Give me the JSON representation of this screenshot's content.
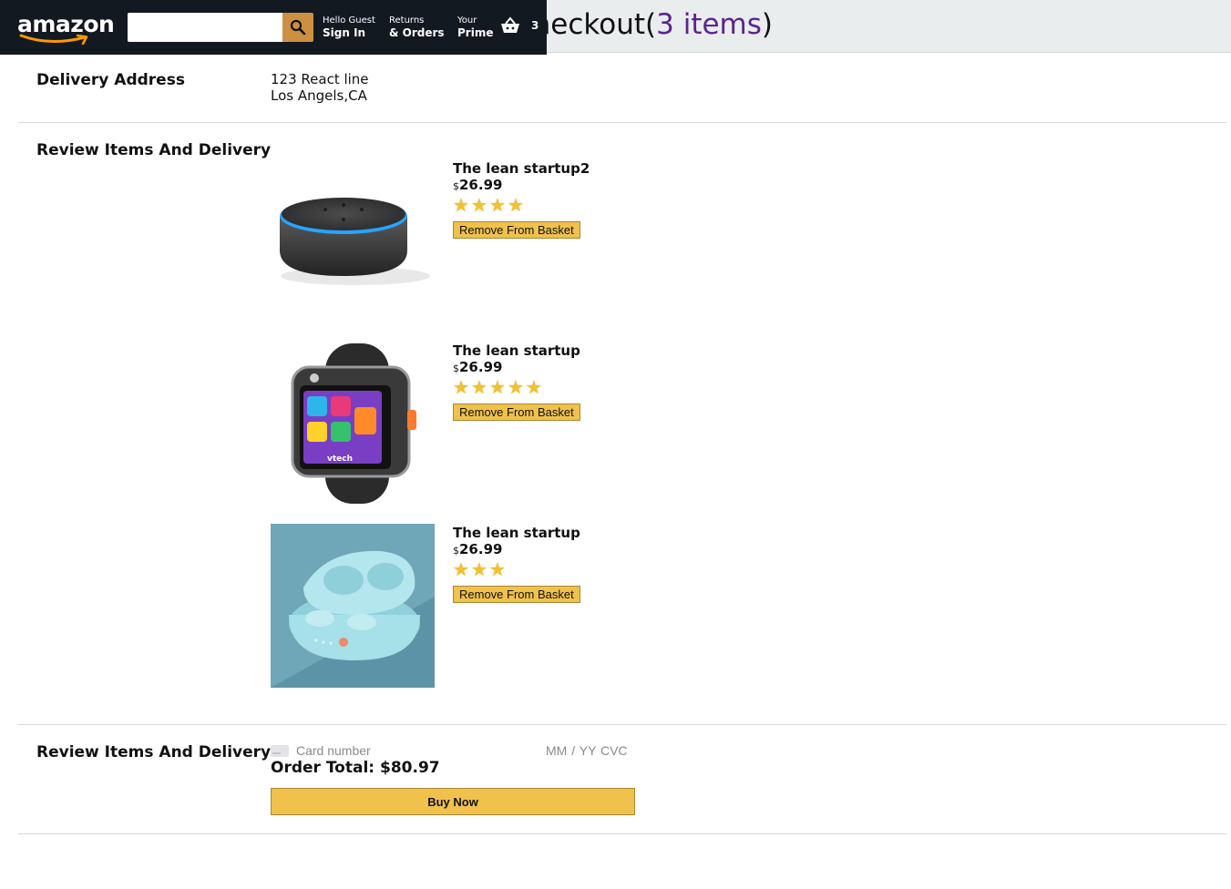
{
  "header": {
    "logo_text": "amazon",
    "search": {
      "value": "",
      "placeholder": ""
    },
    "nav": [
      {
        "line1": "Hello Guest",
        "line2": "Sign In"
      },
      {
        "line1": "Returns",
        "line2": "& Orders"
      },
      {
        "line1": "Your",
        "line2": "Prime"
      }
    ],
    "basket_count": "3"
  },
  "checkout": {
    "title_prefix": "Checkout(",
    "title_count": "3 items",
    "title_suffix": ")"
  },
  "delivery": {
    "title": "Delivery Address",
    "line1": "123 React line",
    "line2": "Los Angels,CA"
  },
  "review": {
    "title": "Review Items And Delivery",
    "items": [
      {
        "title": "The lean startup2",
        "currency": "$",
        "price": "26.99",
        "rating": 4,
        "button": "Remove From Basket",
        "image": "smart-speaker"
      },
      {
        "title": "The lean startup",
        "currency": "$",
        "price": "26.99",
        "rating": 5,
        "button": "Remove From Basket",
        "image": "kids-smartwatch"
      },
      {
        "title": "The lean startup",
        "currency": "$",
        "price": "26.99",
        "rating": 3,
        "button": "Remove From Basket",
        "image": "wireless-earbuds"
      }
    ]
  },
  "payment": {
    "title": "Review Items And Delivery",
    "card_placeholder": "Card number",
    "exp_placeholder": "MM / YY  CVC",
    "order_total": "Order Total: $80.97",
    "buy_label": "Buy Now"
  },
  "colors": {
    "header_bg": "#131921",
    "search_button": "#cd9042",
    "button_yellow": "#f0c14b",
    "count_purple": "#5b2391",
    "star": "#f2c12e"
  }
}
